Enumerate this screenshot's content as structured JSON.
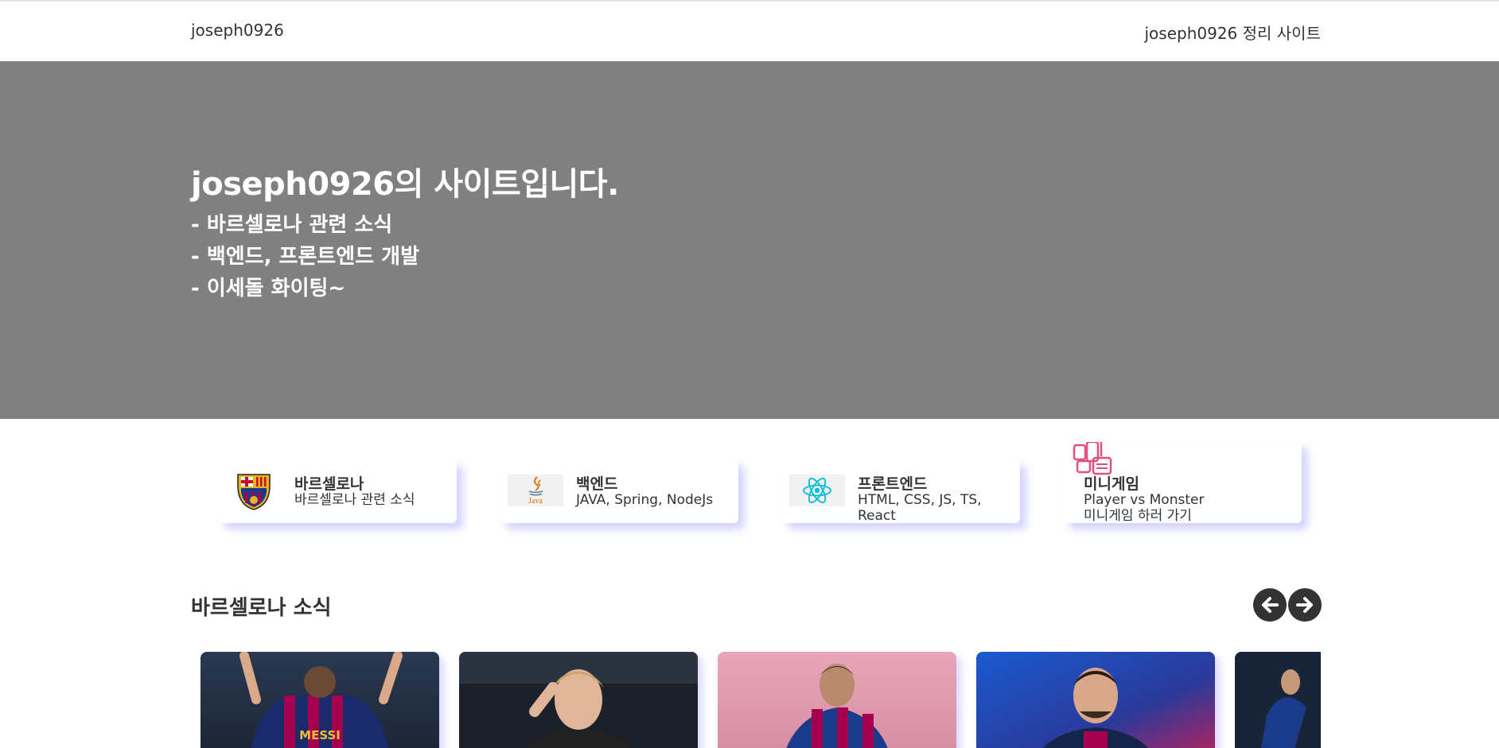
{
  "navbar": {
    "brand": "joseph0926",
    "link": "joseph0926 정리 사이트"
  },
  "hero": {
    "title": "joseph0926의 사이트입니다.",
    "lines": [
      "- 바르셀로나 관련 소식",
      "- 백엔드, 프론트엔드 개발",
      "- 이세돌 화이팅~"
    ]
  },
  "categories": [
    {
      "title": "바르셀로나",
      "desc": "바르셀로나 관련 소식",
      "icon": "fc-barcelona-crest-icon"
    },
    {
      "title": "백엔드",
      "desc": "JAVA, Spring, NodeJs",
      "icon": "java-logo-icon",
      "icon_text": "Java"
    },
    {
      "title": "프론트엔드",
      "desc": "HTML, CSS, JS, TS, React",
      "icon": "react-logo-icon"
    },
    {
      "title": "미니게임",
      "desc_line1": "Player vs Monster",
      "desc_line2": "미니게임 하러 가기",
      "icon": "minigame-logo-icon"
    }
  ],
  "news": {
    "title": "바르셀로나 소식",
    "prev_icon": "arrow-left-icon",
    "next_icon": "arrow-right-icon",
    "cards": [
      {
        "name": "messi-photo",
        "caption": "MESSI"
      },
      {
        "name": "de-jong-photo"
      },
      {
        "name": "pedri-photo"
      },
      {
        "name": "busquets-photo"
      },
      {
        "name": "player-photo-5"
      }
    ]
  },
  "colors": {
    "hero_bg": "#808080",
    "card_shadow": "#a0a0ff",
    "arrow_bg": "#333333",
    "barca_blue": "#1a3a8a",
    "barca_red": "#a5004d"
  }
}
